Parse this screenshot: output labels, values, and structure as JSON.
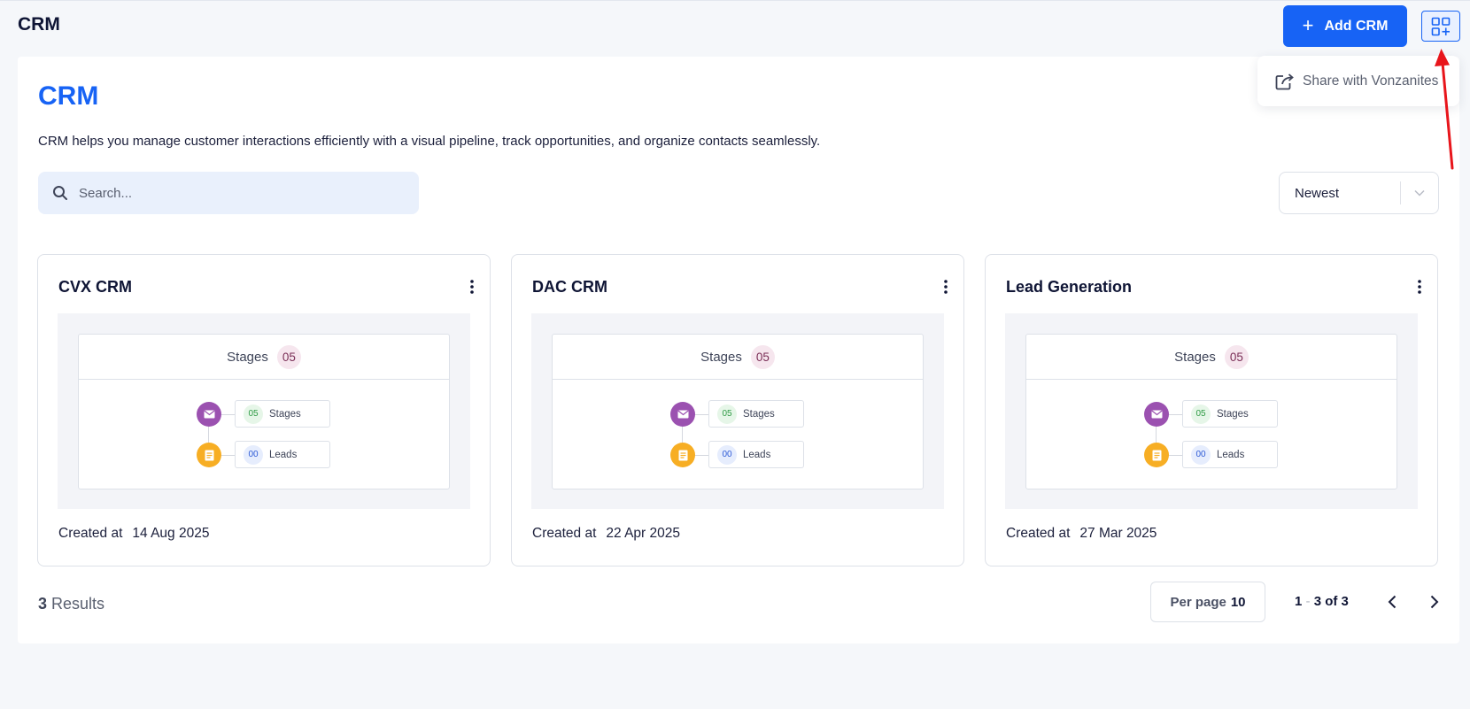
{
  "header": {
    "title": "CRM",
    "add_button_label": "Add CRM",
    "popover_item": "Share with Vonzanites"
  },
  "main": {
    "title": "CRM",
    "description": "CRM helps you manage customer interactions efficiently with a visual pipeline, track opportunities, and organize contacts seamlessly.",
    "search_placeholder": "Search...",
    "sort_selected": "Newest"
  },
  "cards": [
    {
      "title": "CVX CRM",
      "stages_label": "Stages",
      "stages_count": "05",
      "rows": [
        {
          "count": "05",
          "label": "Stages"
        },
        {
          "count": "00",
          "label": "Leads"
        }
      ],
      "created_label": "Created at",
      "created_date": "14 Aug 2025"
    },
    {
      "title": "DAC CRM",
      "stages_label": "Stages",
      "stages_count": "05",
      "rows": [
        {
          "count": "05",
          "label": "Stages"
        },
        {
          "count": "00",
          "label": "Leads"
        }
      ],
      "created_label": "Created at",
      "created_date": "22 Apr 2025"
    },
    {
      "title": "Lead Generation",
      "stages_label": "Stages",
      "stages_count": "05",
      "rows": [
        {
          "count": "05",
          "label": "Stages"
        },
        {
          "count": "00",
          "label": "Leads"
        }
      ],
      "created_label": "Created at",
      "created_date": "27 Mar 2025"
    }
  ],
  "footer": {
    "results_count": "3",
    "results_label": "Results",
    "per_page_label": "Per page",
    "per_page_value": "10",
    "range_start": "1",
    "range_rest": "3 of 3"
  },
  "colors": {
    "accent": "#1763f5",
    "annotation_arrow": "#e8151b",
    "stage_node": "#9b51b0",
    "lead_node": "#f7ae24"
  }
}
